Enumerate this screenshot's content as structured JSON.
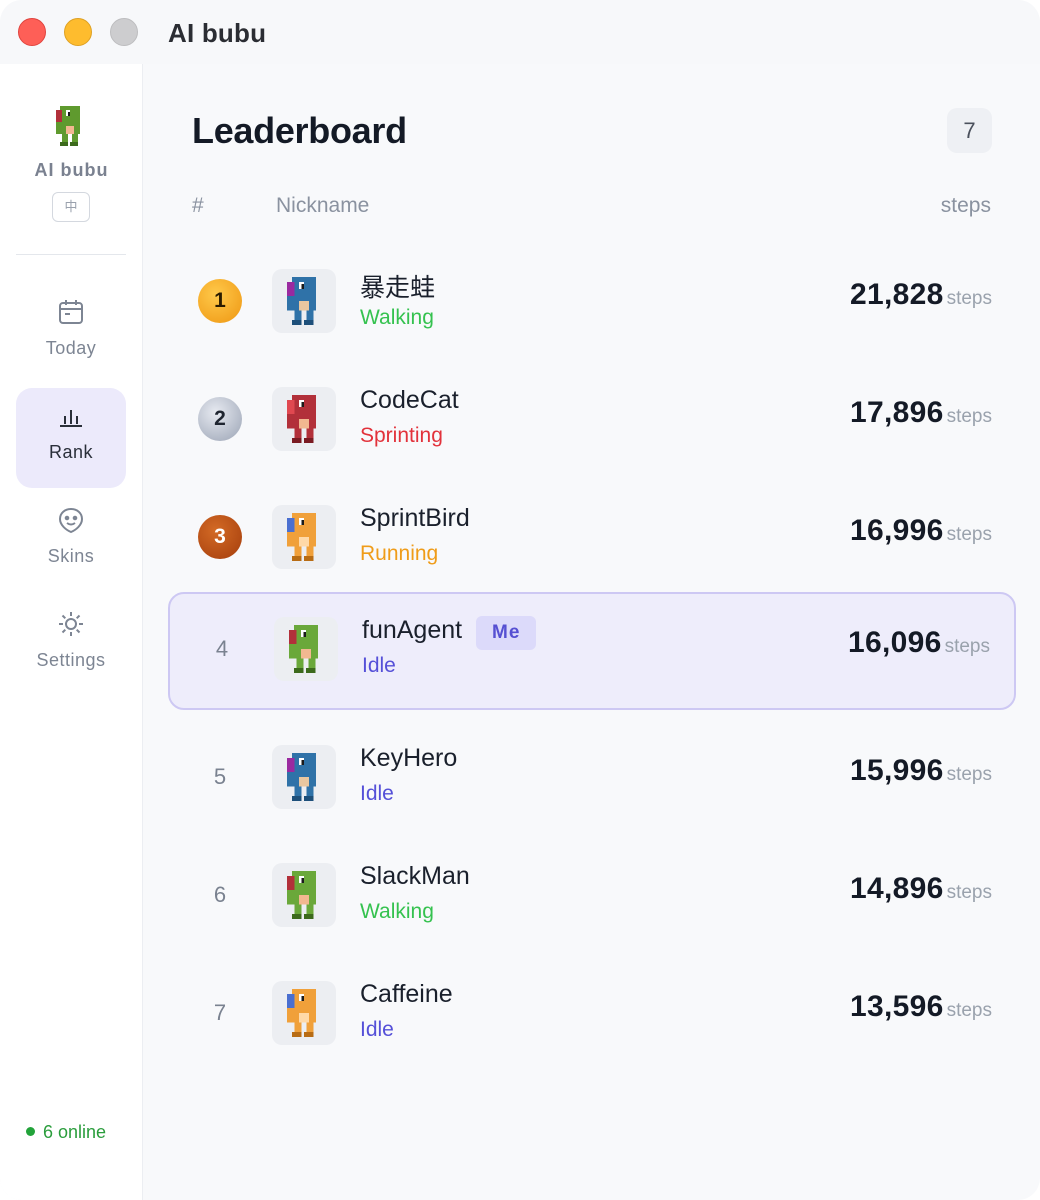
{
  "window": {
    "title": "AI bubu"
  },
  "sidebar": {
    "brand_name": "AI bubu",
    "lang_button": "中",
    "nav": [
      {
        "label": "Today",
        "icon": "calendar-icon"
      },
      {
        "label": "Rank",
        "icon": "bar-chart-icon",
        "active": true
      },
      {
        "label": "Skins",
        "icon": "face-icon"
      },
      {
        "label": "Settings",
        "icon": "sun-icon"
      }
    ],
    "online_text": "6 online"
  },
  "leaderboard": {
    "title": "Leaderboard",
    "count": "7",
    "columns": {
      "rank": "#",
      "nickname": "Nickname",
      "steps": "steps"
    },
    "rows": [
      {
        "rank": "1",
        "medal": "gold",
        "nickname": "暴走蛙",
        "status": "Walking",
        "status_type": "walking",
        "steps": "21,828",
        "unit": "steps",
        "skin": "blue"
      },
      {
        "rank": "2",
        "medal": "silver",
        "nickname": "CodeCat",
        "status": "Sprinting",
        "status_type": "sprinting",
        "steps": "17,896",
        "unit": "steps",
        "skin": "red"
      },
      {
        "rank": "3",
        "medal": "bronze",
        "nickname": "SprintBird",
        "status": "Running",
        "status_type": "running",
        "steps": "16,996",
        "unit": "steps",
        "skin": "orange"
      },
      {
        "rank": "4",
        "nickname": "funAgent",
        "me_label": "Me",
        "status": "Idle",
        "status_type": "idle",
        "steps": "16,096",
        "unit": "steps",
        "skin": "green"
      },
      {
        "rank": "5",
        "nickname": "KeyHero",
        "status": "Idle",
        "status_type": "idle",
        "steps": "15,996",
        "unit": "steps",
        "skin": "blue"
      },
      {
        "rank": "6",
        "nickname": "SlackMan",
        "status": "Walking",
        "status_type": "walking",
        "steps": "14,896",
        "unit": "steps",
        "skin": "green"
      },
      {
        "rank": "7",
        "nickname": "Caffeine",
        "status": "Idle",
        "status_type": "idle",
        "steps": "13,596",
        "unit": "steps",
        "skin": "orange"
      }
    ]
  },
  "colors": {
    "accent": "#5650d2",
    "walking": "#35c24f",
    "sprinting": "#e2323b",
    "running": "#ef9c19",
    "idle": "#5550d8",
    "skin_blue": "#2f72a8",
    "skin_red": "#b2303a",
    "skin_orange": "#f0a03a",
    "skin_green": "#6aa83a"
  }
}
